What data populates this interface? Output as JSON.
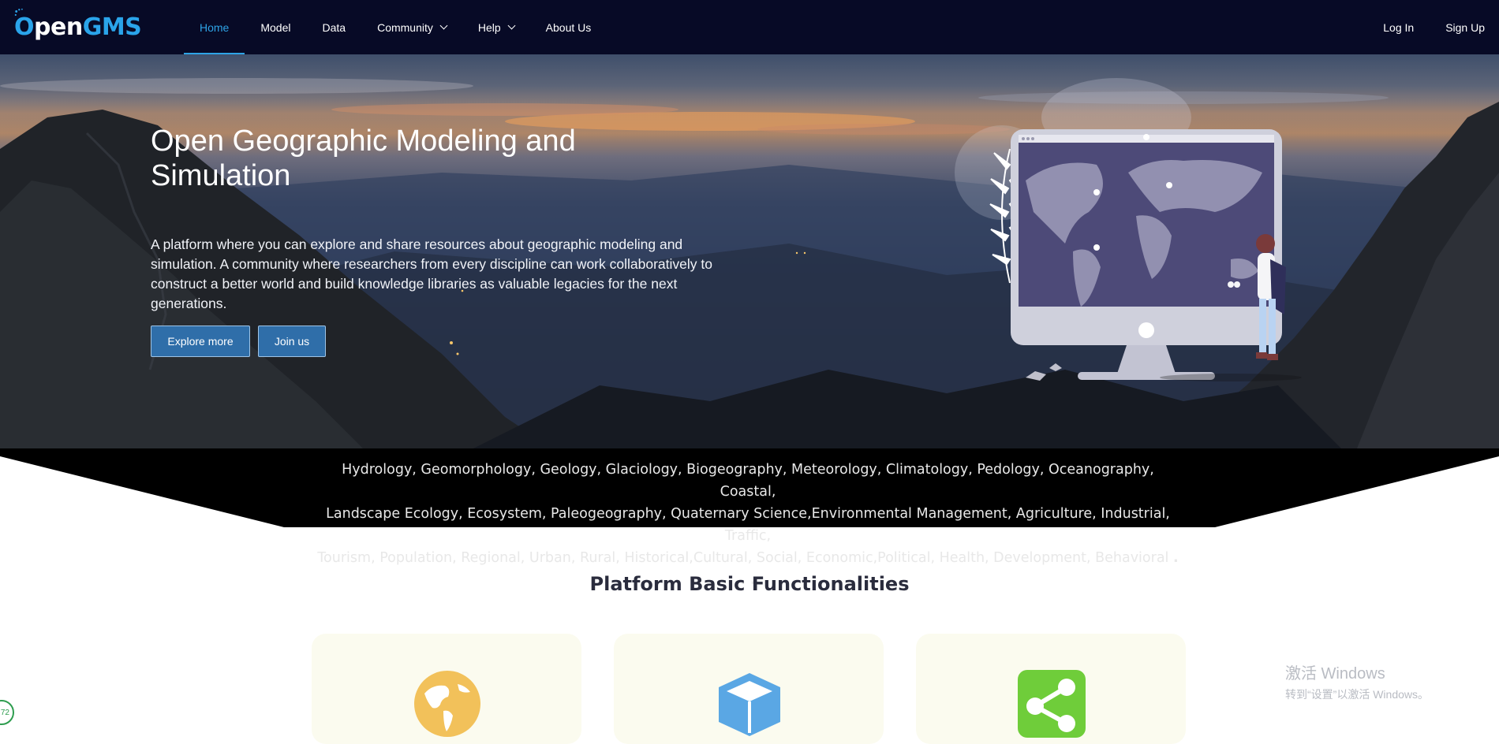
{
  "nav": {
    "logo_prefix": "O",
    "logo_pen": "pen",
    "logo_suffix": "GMS",
    "items": [
      {
        "label": "Home",
        "active": true
      },
      {
        "label": "Model"
      },
      {
        "label": "Data"
      },
      {
        "label": "Community",
        "dropdown": true
      },
      {
        "label": "Help",
        "dropdown": true
      },
      {
        "label": "About Us"
      }
    ],
    "login": "Log In",
    "signup": "Sign Up"
  },
  "hero": {
    "title": "Open Geographic Modeling and Simulation",
    "description": "A platform where you can explore and share resources about geographic modeling and simulation. A community where researchers from every discipline can work collaboratively to construct a better world and build knowledge libraries as valuable legacies for the next generations.",
    "explore_label": "Explore more",
    "join_label": "Join us"
  },
  "disciplines": {
    "line1": "Hydrology, Geomorphology, Geology, Glaciology, Biogeography, Meteorology, Climatology, Pedology, Oceanography, Coastal,",
    "line2": "Landscape Ecology, Ecosystem, Paleogeography, Quaternary Science,Environmental Management, Agriculture, Industrial, Traffic,",
    "line3": "Tourism, Population, Regional, Urban, Rural, Historical,Cultural, Social, Economic,Political, Health, Development, Behavioral",
    "ellipsis": ". . ."
  },
  "functionalities": {
    "title": "Platform Basic Functionalities",
    "cards": [
      {
        "icon": "globe-icon",
        "color": "#f2c15a"
      },
      {
        "icon": "cube-icon",
        "color": "#5aa7e4"
      },
      {
        "icon": "share-icon",
        "color": "#6fcd3a"
      }
    ]
  },
  "watermark": {
    "line1": "激活 Windows",
    "line2": "转到“设置”以激活 Windows。"
  },
  "badge": {
    "text": "72"
  },
  "colors": {
    "nav_bg": "#070a26",
    "accent": "#2ea3e6",
    "button": "#2f6ea9"
  }
}
